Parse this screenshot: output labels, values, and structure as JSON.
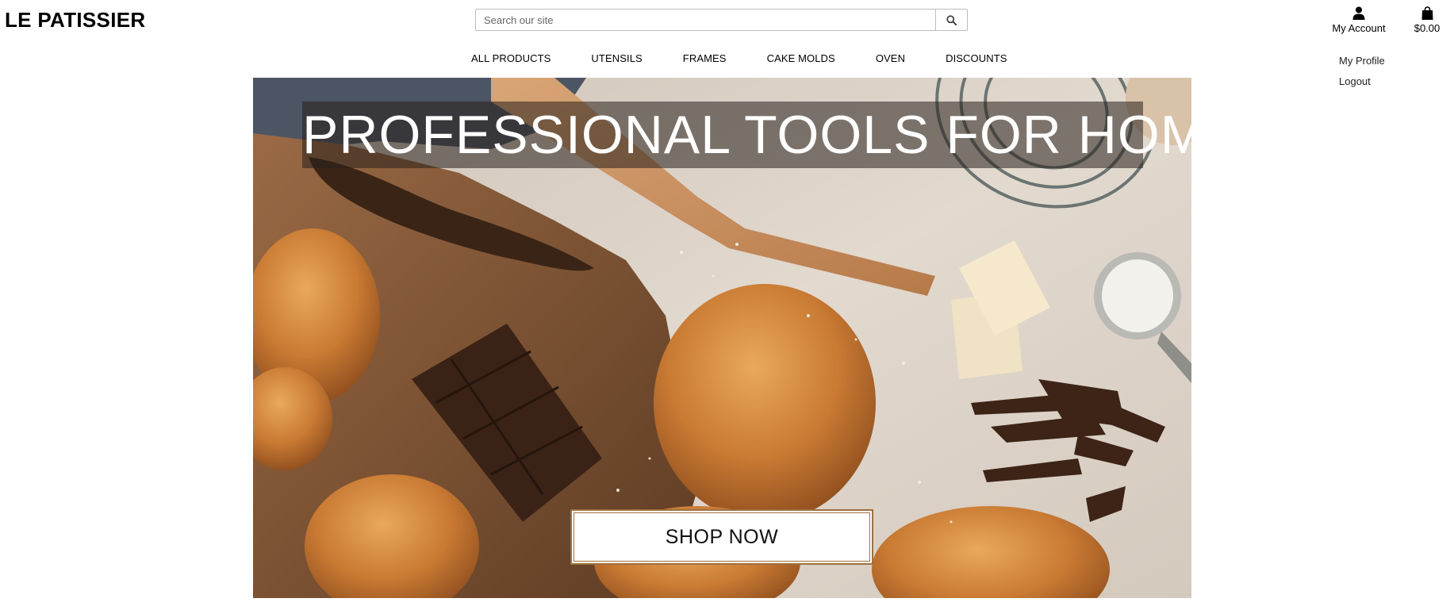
{
  "header": {
    "brand": "LE PATISSIER",
    "search": {
      "placeholder": "Search our site",
      "value": "",
      "button_icon": "search-icon"
    },
    "account": {
      "icon": "user-icon",
      "label": "My Account"
    },
    "bag": {
      "icon": "shopping-bag-icon",
      "total": "$0.00"
    },
    "account_menu": [
      {
        "label": "My Profile"
      },
      {
        "label": "Logout"
      }
    ]
  },
  "nav": {
    "items": [
      {
        "label": "ALL PRODUCTS"
      },
      {
        "label": "UTENSILS"
      },
      {
        "label": "FRAMES"
      },
      {
        "label": "CAKE MOLDS"
      },
      {
        "label": "OVEN"
      },
      {
        "label": "DISCOUNTS"
      }
    ]
  },
  "hero": {
    "title": "PROFESSIONAL TOOLS FOR HOME",
    "cta": "SHOP NOW"
  }
}
